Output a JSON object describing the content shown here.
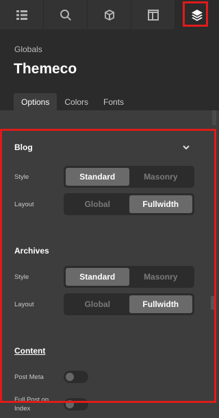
{
  "toolbar": {
    "items": [
      {
        "icon": "list-icon"
      },
      {
        "icon": "search-icon"
      },
      {
        "icon": "cube-icon"
      },
      {
        "icon": "layout-icon"
      },
      {
        "icon": "layers-icon",
        "active": true
      }
    ]
  },
  "header": {
    "breadcrumb": "Globals",
    "title": "Themeco",
    "tabs": [
      {
        "label": "Options",
        "active": true
      },
      {
        "label": "Colors"
      },
      {
        "label": "Fonts"
      }
    ]
  },
  "blog": {
    "title": "Blog",
    "style": {
      "label": "Style",
      "options": [
        "Standard",
        "Masonry"
      ],
      "selected": "Standard"
    },
    "layout": {
      "label": "Layout",
      "options": [
        "Global",
        "Fullwidth"
      ],
      "selected": "Fullwidth"
    }
  },
  "archives": {
    "title": "Archives",
    "style": {
      "label": "Style",
      "options": [
        "Standard",
        "Masonry"
      ],
      "selected": "Standard"
    },
    "layout": {
      "label": "Layout",
      "options": [
        "Global",
        "Fullwidth"
      ],
      "selected": "Fullwidth"
    }
  },
  "content": {
    "title": "Content",
    "post_meta": {
      "label": "Post Meta",
      "on": false
    },
    "full_post": {
      "label_line1": "Full Post on",
      "label_line2": "Index",
      "on": false
    }
  },
  "colors": {
    "highlight": "#e01b1b",
    "panel_bg": "#3d3d3d",
    "header_bg": "#2b2b2b"
  }
}
